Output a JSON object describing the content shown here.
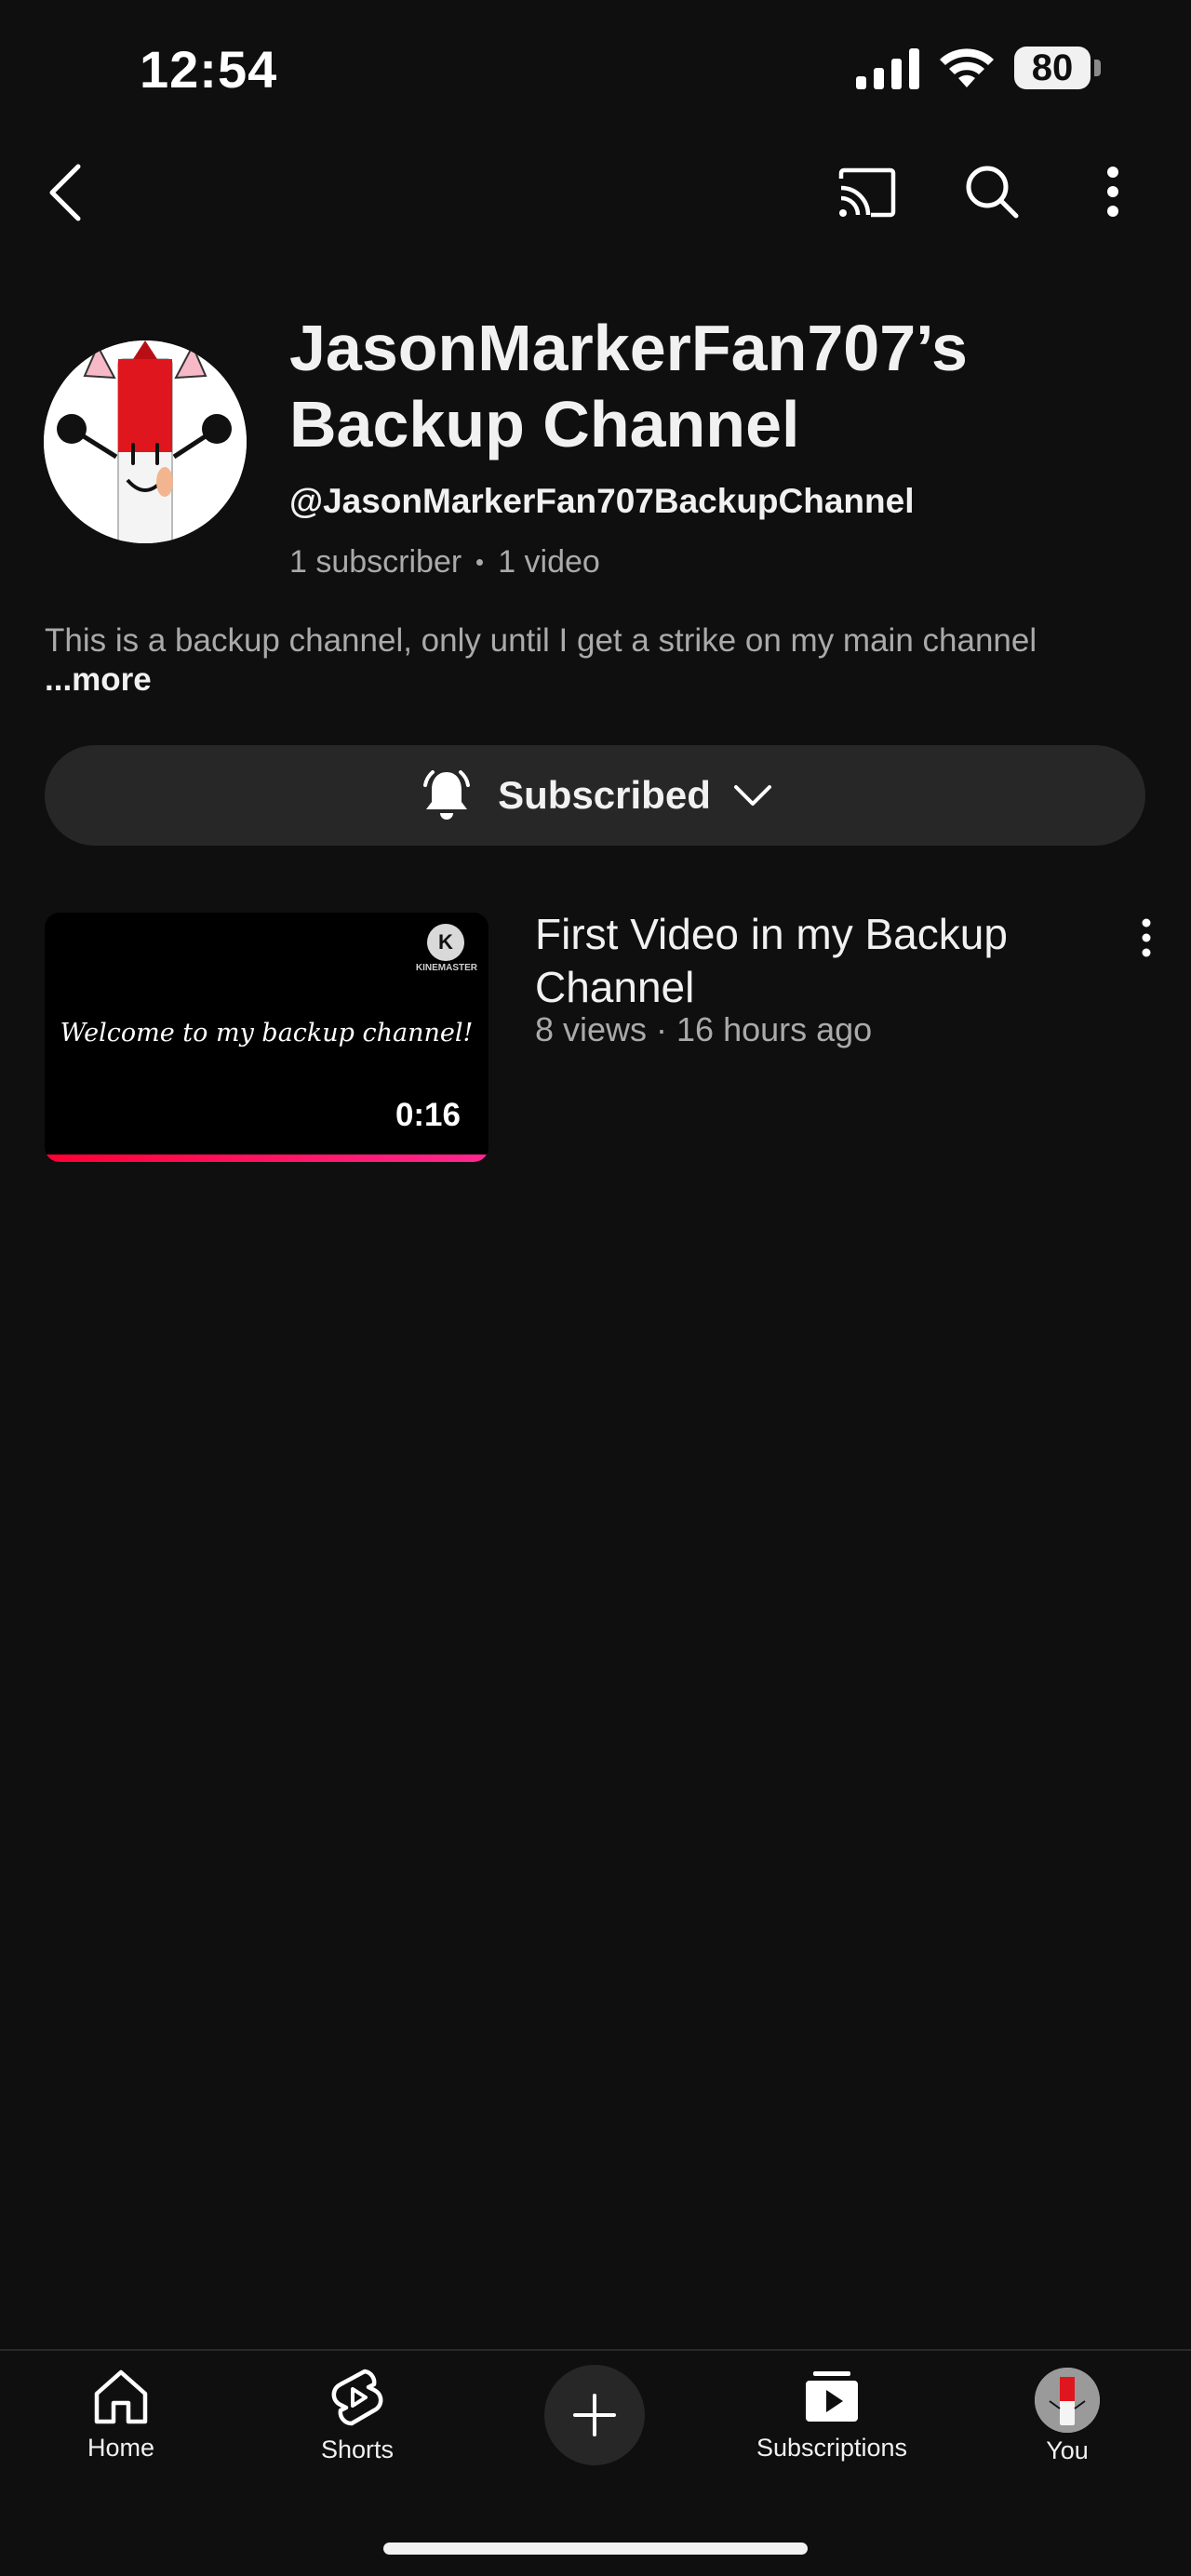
{
  "status_bar": {
    "time": "12:54",
    "battery": "80",
    "icons": [
      "signal-icon",
      "wifi-icon",
      "battery-icon"
    ]
  },
  "top_bar": {
    "icons": [
      "back-icon",
      "cast-icon",
      "search-icon",
      "more-vert-icon"
    ]
  },
  "channel": {
    "title_line1": "JasonMarkerFan707’s",
    "title_line2": "Backup Channel",
    "handle": "@JasonMarkerFan707BackupChannel",
    "subscribers": "1 subscriber",
    "videos": "1 video",
    "description": "This is a backup channel, only until I get a strike on my main channel",
    "more_label": "...more"
  },
  "subscribe": {
    "label": "Subscribed",
    "icons": [
      "bell-icon",
      "chevron-down-icon"
    ]
  },
  "videos": [
    {
      "title": "First Video in my Backup Channel",
      "meta": "8 views · 16 hours ago",
      "thumbnail_text": "Welcome to my backup channel!",
      "thumbnail_watermark": "KINEMASTER",
      "duration": "0:16",
      "watched_progress": 1.0
    }
  ],
  "bottom_nav": {
    "items": [
      {
        "label": "Home",
        "icon": "home-icon"
      },
      {
        "label": "Shorts",
        "icon": "shorts-icon"
      },
      {
        "label": "",
        "icon": "create-plus-icon"
      },
      {
        "label": "Subscriptions",
        "icon": "subscriptions-icon"
      },
      {
        "label": "You",
        "icon": "you-avatar"
      }
    ]
  },
  "colors": {
    "background": "#0f0f0f",
    "surface": "#272727",
    "primary_text": "#f1f1f1",
    "secondary_text": "#aaaaaa",
    "progress_red": "#ff0033"
  }
}
